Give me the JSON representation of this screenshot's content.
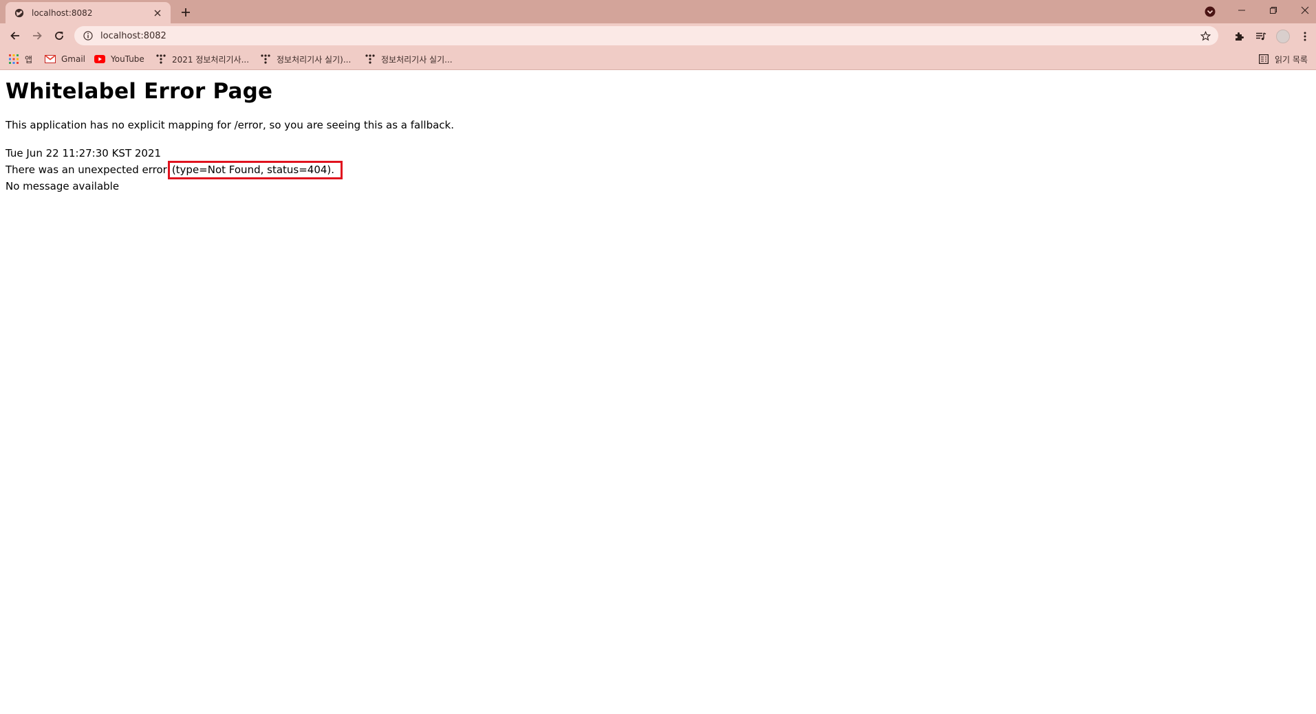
{
  "browser": {
    "tab": {
      "title": "localhost:8082"
    },
    "omnibox": {
      "url": "localhost:8082"
    },
    "bookmarks": [
      {
        "label": "앱"
      },
      {
        "label": "Gmail"
      },
      {
        "label": "YouTube"
      },
      {
        "label": "2021 정보처리기사..."
      },
      {
        "label": "정보처리기사 실기)..."
      },
      {
        "label": "정보처리기사 실기..."
      }
    ],
    "reading_list": {
      "label": "읽기 목록"
    },
    "colors": {
      "frame": "#d3a49a",
      "toolbar": "#f0ccc6",
      "omnibox": "#fbe9e6",
      "highlight": "#e0121e"
    },
    "icons": [
      "globe-icon",
      "close-icon",
      "plus-icon",
      "back-arrow-icon",
      "forward-arrow-icon",
      "reload-icon",
      "info-icon",
      "star-icon",
      "puzzle-icon",
      "media-icon",
      "avatar",
      "kebab-menu-icon"
    ]
  },
  "page": {
    "heading": "Whitelabel Error Page",
    "description": "This application has no explicit mapping for /error, so you are seeing this as a fallback.",
    "timestamp": "Tue Jun 22 11:27:30 KST 2021",
    "error_prefix": "There was an unexpected error",
    "error_detail": "(type=Not Found, status=404).",
    "message": "No message available"
  }
}
